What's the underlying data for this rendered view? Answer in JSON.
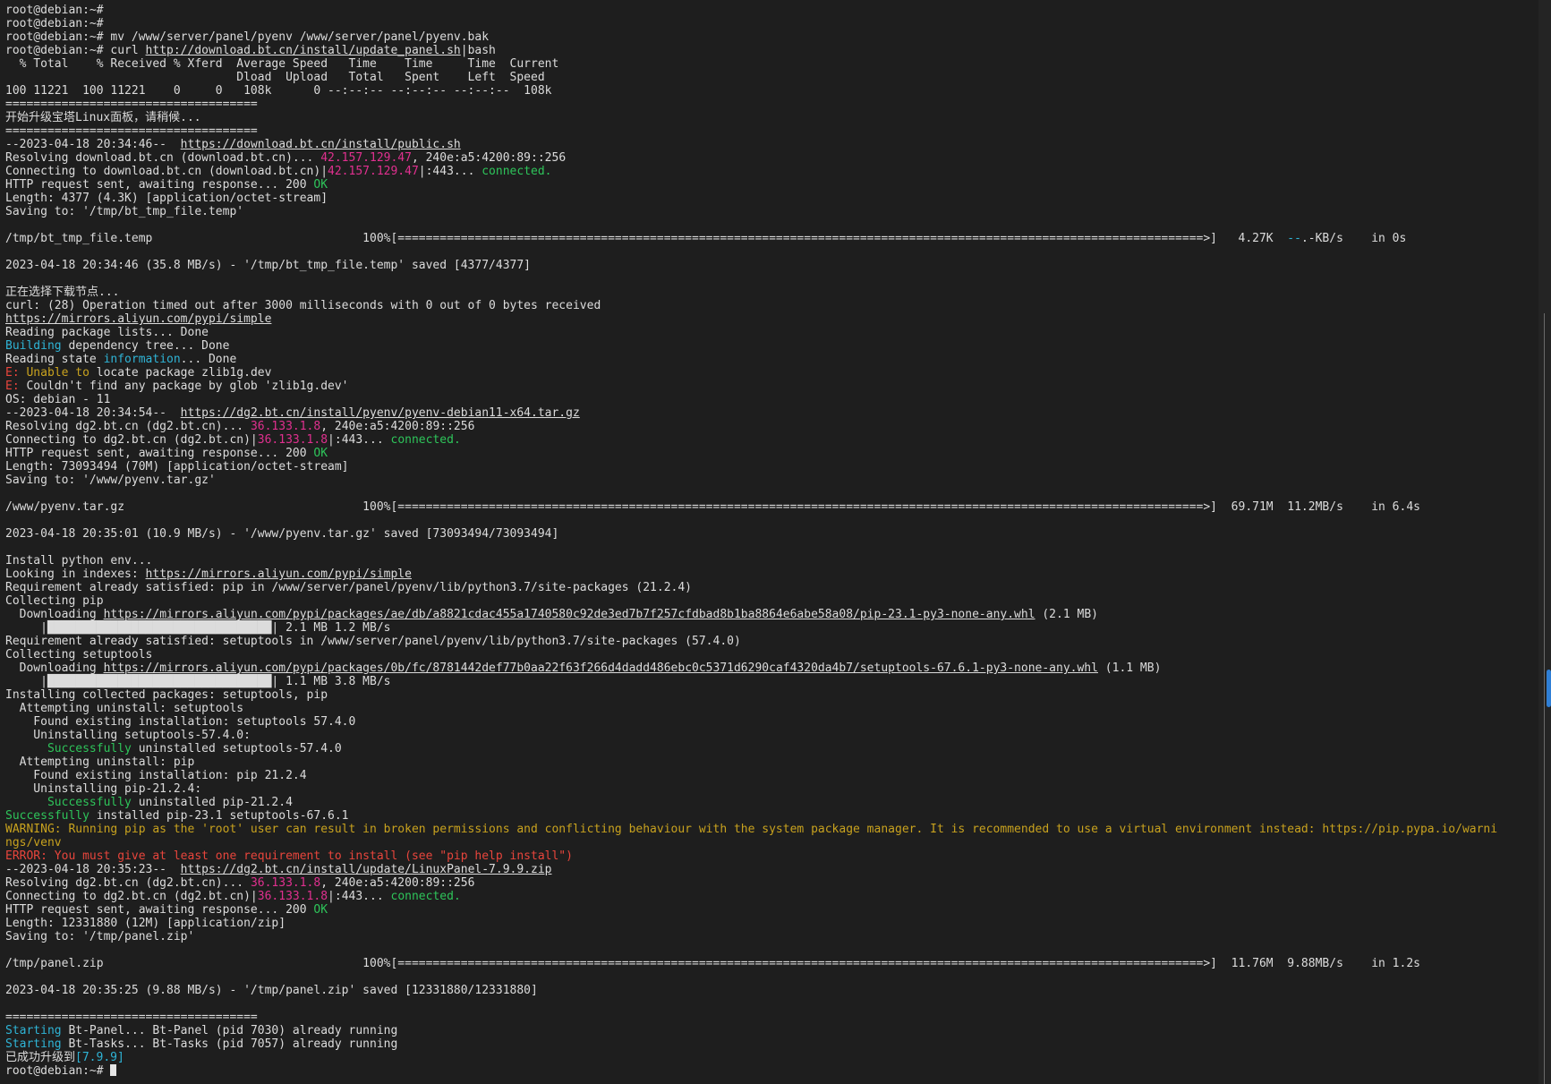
{
  "terminal": {
    "lines": [
      [
        {
          "t": "root@debian:~#"
        }
      ],
      [
        {
          "t": "root@debian:~#"
        }
      ],
      [
        {
          "t": "root@debian:~# mv /www/server/panel/pyenv /www/server/panel/pyenv.bak"
        }
      ],
      [
        {
          "t": "root@debian:~# curl "
        },
        {
          "t": "http://download.bt.cn/install/update_panel.sh",
          "c": "u"
        },
        {
          "t": "|bash"
        }
      ],
      [
        {
          "t": "  % Total    % Received % Xferd  Average Speed   Time    Time     Time  Current"
        }
      ],
      [
        {
          "t": "                                 Dload  Upload   Total   Spent    Left  Speed"
        }
      ],
      [
        {
          "t": "100 11221  100 11221    0     0   108k      0 --:--:-- --:--:-- --:--:--  108k"
        }
      ],
      [
        {
          "t": "===================================="
        }
      ],
      [
        {
          "t": "开始升级宝塔Linux面板，请稍候..."
        }
      ],
      [
        {
          "t": "===================================="
        }
      ],
      [
        {
          "t": "--2023-04-18 20:34:46--  "
        },
        {
          "t": "https://download.bt.cn/install/public.sh",
          "c": "u"
        }
      ],
      [
        {
          "t": "Resolving download.bt.cn (download.bt.cn)... "
        },
        {
          "t": "42.157.129.47",
          "c": "mag"
        },
        {
          "t": ", 240e:a5:4200:89::256"
        }
      ],
      [
        {
          "t": "Connecting to download.bt.cn (download.bt.cn)|"
        },
        {
          "t": "42.157.129.47",
          "c": "mag"
        },
        {
          "t": "|:443... "
        },
        {
          "t": "connected.",
          "c": "grn"
        }
      ],
      [
        {
          "t": "HTTP request sent, awaiting response... 200 "
        },
        {
          "t": "OK",
          "c": "grn"
        }
      ],
      [
        {
          "t": "Length: 4377 (4.3K) [application/octet-stream]"
        }
      ],
      [
        {
          "t": "Saving to: '/tmp/bt_tmp_file.temp'"
        }
      ],
      [
        {
          "t": ""
        }
      ],
      [
        {
          "t": "/tmp/bt_tmp_file.temp                              100%[===================================================================================================================>]   4.27K  "
        },
        {
          "t": "--",
          "c": "cyan"
        },
        {
          "t": ".-KB/s    in 0s"
        }
      ],
      [
        {
          "t": ""
        }
      ],
      [
        {
          "t": "2023-04-18 20:34:46 (35.8 MB/s) - '/tmp/bt_tmp_file.temp' saved [4377/4377]"
        }
      ],
      [
        {
          "t": ""
        }
      ],
      [
        {
          "t": "正在选择下载节点..."
        }
      ],
      [
        {
          "t": "curl: (28) Operation timed out after 3000 milliseconds with 0 out of 0 bytes received"
        }
      ],
      [
        {
          "t": "https://mirrors.aliyun.com/pypi/simple",
          "c": "u"
        }
      ],
      [
        {
          "t": "Reading package lists... Done"
        }
      ],
      [
        {
          "t": "Building",
          "c": "cyan"
        },
        {
          "t": " dependency tree... Done"
        }
      ],
      [
        {
          "t": "Reading state "
        },
        {
          "t": "information",
          "c": "cyan"
        },
        {
          "t": "... Done"
        }
      ],
      [
        {
          "t": "E:",
          "c": "red"
        },
        {
          "t": " "
        },
        {
          "t": "Unable to",
          "c": "yel"
        },
        {
          "t": " locate package zlib1g.dev"
        }
      ],
      [
        {
          "t": "E:",
          "c": "red"
        },
        {
          "t": " Couldn't find any package by glob 'zlib1g.dev'"
        }
      ],
      [
        {
          "t": "OS: debian - 11"
        }
      ],
      [
        {
          "t": "--2023-04-18 20:34:54--  "
        },
        {
          "t": "https://dg2.bt.cn/install/pyenv/pyenv-debian11-x64.tar.gz",
          "c": "u"
        }
      ],
      [
        {
          "t": "Resolving dg2.bt.cn (dg2.bt.cn)... "
        },
        {
          "t": "36.133.1.8",
          "c": "mag"
        },
        {
          "t": ", 240e:a5:4200:89::256"
        }
      ],
      [
        {
          "t": "Connecting to dg2.bt.cn (dg2.bt.cn)|"
        },
        {
          "t": "36.133.1.8",
          "c": "mag"
        },
        {
          "t": "|:443... "
        },
        {
          "t": "connected.",
          "c": "grn"
        }
      ],
      [
        {
          "t": "HTTP request sent, awaiting response... 200 "
        },
        {
          "t": "OK",
          "c": "grn"
        }
      ],
      [
        {
          "t": "Length: 73093494 (70M) [application/octet-stream]"
        }
      ],
      [
        {
          "t": "Saving to: '/www/pyenv.tar.gz'"
        }
      ],
      [
        {
          "t": ""
        }
      ],
      [
        {
          "t": "/www/pyenv.tar.gz                                  100%[===================================================================================================================>]  69.71M  11.2MB/s    in 6.4s"
        }
      ],
      [
        {
          "t": ""
        }
      ],
      [
        {
          "t": "2023-04-18 20:35:01 (10.9 MB/s) - '/www/pyenv.tar.gz' saved [73093494/73093494]"
        }
      ],
      [
        {
          "t": ""
        }
      ],
      [
        {
          "t": "Install python env..."
        }
      ],
      [
        {
          "t": "Looking in indexes: "
        },
        {
          "t": "https://mirrors.aliyun.com/pypi/simple",
          "c": "u"
        }
      ],
      [
        {
          "t": "Requirement already satisfied: pip in /www/server/panel/pyenv/lib/python3.7/site-packages (21.2.4)"
        }
      ],
      [
        {
          "t": "Collecting pip"
        }
      ],
      [
        {
          "t": "  Downloading "
        },
        {
          "t": "https://mirrors.aliyun.com/pypi/packages/ae/db/a8821cdac455a1740580c92de3ed7b7f257cfdbad8b1ba8864e6abe58a08/pip-23.1-py3-none-any.whl",
          "c": "u"
        },
        {
          "t": " (2.1 MB)"
        }
      ],
      [
        {
          "t": "     |████████████████████████████████| 2.1 MB 1.2 MB/s"
        }
      ],
      [
        {
          "t": "Requirement already satisfied: setuptools in /www/server/panel/pyenv/lib/python3.7/site-packages (57.4.0)"
        }
      ],
      [
        {
          "t": "Collecting setuptools"
        }
      ],
      [
        {
          "t": "  Downloading "
        },
        {
          "t": "https://mirrors.aliyun.com/pypi/packages/0b/fc/8781442def77b0aa22f63f266d4dadd486ebc0c5371d6290caf4320da4b7/setuptools-67.6.1-py3-none-any.whl",
          "c": "u"
        },
        {
          "t": " (1.1 MB)"
        }
      ],
      [
        {
          "t": "     |████████████████████████████████| 1.1 MB 3.8 MB/s"
        }
      ],
      [
        {
          "t": "Installing collected packages: setuptools, pip"
        }
      ],
      [
        {
          "t": "  Attempting uninstall: setuptools"
        }
      ],
      [
        {
          "t": "    Found existing installation: setuptools 57.4.0"
        }
      ],
      [
        {
          "t": "    Uninstalling setuptools-57.4.0:"
        }
      ],
      [
        {
          "t": "      "
        },
        {
          "t": "Successfully",
          "c": "grn"
        },
        {
          "t": " uninstalled setuptools-57.4.0"
        }
      ],
      [
        {
          "t": "  Attempting uninstall: pip"
        }
      ],
      [
        {
          "t": "    Found existing installation: pip 21.2.4"
        }
      ],
      [
        {
          "t": "    Uninstalling pip-21.2.4:"
        }
      ],
      [
        {
          "t": "      "
        },
        {
          "t": "Successfully",
          "c": "grn"
        },
        {
          "t": " uninstalled pip-21.2.4"
        }
      ],
      [
        {
          "t": "Successfully",
          "c": "grn"
        },
        {
          "t": " installed pip-23.1 setuptools-67.6.1"
        }
      ],
      [
        {
          "t": "WARNING: Running pip as the 'root' user can result in broken permissions and conflicting behaviour with the system package manager. It is recommended to use a virtual environment instead: https://pip.pypa.io/warni",
          "c": "yel"
        }
      ],
      [
        {
          "t": "ngs/venv",
          "c": "yel"
        }
      ],
      [
        {
          "t": "ERROR: You must give at least one requirement to install (see \"pip help install\")",
          "c": "red"
        }
      ],
      [
        {
          "t": "--2023-04-18 20:35:23--  "
        },
        {
          "t": "https://dg2.bt.cn/install/update/LinuxPanel-7.9.9.zip",
          "c": "u"
        }
      ],
      [
        {
          "t": "Resolving dg2.bt.cn (dg2.bt.cn)... "
        },
        {
          "t": "36.133.1.8",
          "c": "mag"
        },
        {
          "t": ", 240e:a5:4200:89::256"
        }
      ],
      [
        {
          "t": "Connecting to dg2.bt.cn (dg2.bt.cn)|"
        },
        {
          "t": "36.133.1.8",
          "c": "mag"
        },
        {
          "t": "|:443... "
        },
        {
          "t": "connected.",
          "c": "grn"
        }
      ],
      [
        {
          "t": "HTTP request sent, awaiting response... 200 "
        },
        {
          "t": "OK",
          "c": "grn"
        }
      ],
      [
        {
          "t": "Length: 12331880 (12M) [application/zip]"
        }
      ],
      [
        {
          "t": "Saving to: '/tmp/panel.zip'"
        }
      ],
      [
        {
          "t": ""
        }
      ],
      [
        {
          "t": "/tmp/panel.zip                                     100%[===================================================================================================================>]  11.76M  9.88MB/s    in 1.2s"
        }
      ],
      [
        {
          "t": ""
        }
      ],
      [
        {
          "t": "2023-04-18 20:35:25 (9.88 MB/s) - '/tmp/panel.zip' saved [12331880/12331880]"
        }
      ],
      [
        {
          "t": ""
        }
      ],
      [
        {
          "t": "===================================="
        }
      ],
      [
        {
          "t": "Starting",
          "c": "cyan"
        },
        {
          "t": " Bt-Panel... Bt-Panel (pid 7030) already running"
        }
      ],
      [
        {
          "t": "Starting",
          "c": "cyan"
        },
        {
          "t": " Bt-Tasks... Bt-Tasks (pid 7057) already running"
        }
      ],
      [
        {
          "t": "已成功升级到"
        },
        {
          "t": "[7.9.9]",
          "c": "cyan"
        }
      ],
      [
        {
          "t": "root@debian:~# "
        }
      ]
    ]
  },
  "colors": {
    "background": "#1e1e1e",
    "text": "#dcdcdc",
    "ip": "#e0308f",
    "success": "#2ec45a",
    "info": "#2fb4d6",
    "warning": "#c8a21e",
    "error": "#e8453c",
    "scroll_thumb": "#2f7fd6"
  }
}
